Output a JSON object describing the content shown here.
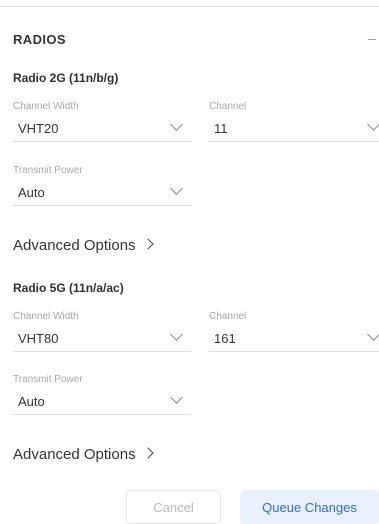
{
  "section": {
    "title": "RADIOS",
    "collapse_symbol": "–"
  },
  "radios": [
    {
      "title": "Radio 2G (11n/b/g)",
      "channel_width": {
        "label": "Channel Width",
        "value": "VHT20"
      },
      "channel": {
        "label": "Channel",
        "value": "11"
      },
      "transmit_power": {
        "label": "Transmit Power",
        "value": "Auto"
      },
      "advanced_label": "Advanced Options"
    },
    {
      "title": "Radio 5G (11n/a/ac)",
      "channel_width": {
        "label": "Channel Width",
        "value": "VHT80"
      },
      "channel": {
        "label": "Channel",
        "value": "161"
      },
      "transmit_power": {
        "label": "Transmit Power",
        "value": "Auto"
      },
      "advanced_label": "Advanced Options"
    }
  ],
  "footer": {
    "cancel_label": "Cancel",
    "queue_label": "Queue Changes"
  },
  "icons": [
    "collapse-icon",
    "chevron-down-icon",
    "chevron-right-icon"
  ],
  "colors": {
    "accent": "#2d6fd1",
    "accent_bg": "#e8f1fd",
    "label_gray": "#a7a7a7",
    "divider": "#dcdcdc"
  }
}
